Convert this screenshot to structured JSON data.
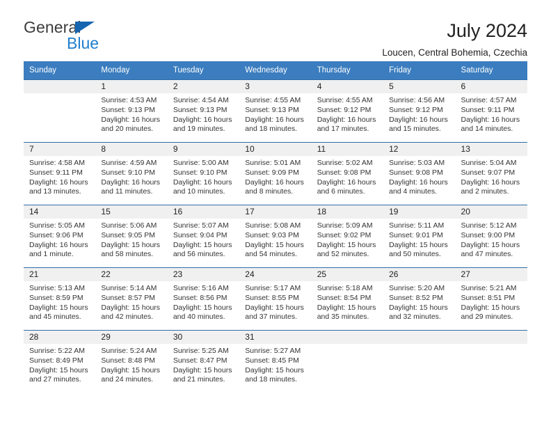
{
  "brand": {
    "name_top": "General",
    "name_bottom": "Blue",
    "accent_color": "#1f7fd0",
    "triangle_color": "#1565b0"
  },
  "header": {
    "title": "July 2024",
    "subtitle": "Loucen, Central Bohemia, Czechia"
  },
  "calendar": {
    "header_bg": "#3b7dbf",
    "row_divider": "#2f6ca8",
    "daynum_bg": "#f0f0f0",
    "weekdays": [
      "Sunday",
      "Monday",
      "Tuesday",
      "Wednesday",
      "Thursday",
      "Friday",
      "Saturday"
    ],
    "weeks": [
      [
        {
          "day": "",
          "info": ""
        },
        {
          "day": "1",
          "info": "Sunrise: 4:53 AM\nSunset: 9:13 PM\nDaylight: 16 hours\nand 20 minutes."
        },
        {
          "day": "2",
          "info": "Sunrise: 4:54 AM\nSunset: 9:13 PM\nDaylight: 16 hours\nand 19 minutes."
        },
        {
          "day": "3",
          "info": "Sunrise: 4:55 AM\nSunset: 9:13 PM\nDaylight: 16 hours\nand 18 minutes."
        },
        {
          "day": "4",
          "info": "Sunrise: 4:55 AM\nSunset: 9:12 PM\nDaylight: 16 hours\nand 17 minutes."
        },
        {
          "day": "5",
          "info": "Sunrise: 4:56 AM\nSunset: 9:12 PM\nDaylight: 16 hours\nand 15 minutes."
        },
        {
          "day": "6",
          "info": "Sunrise: 4:57 AM\nSunset: 9:11 PM\nDaylight: 16 hours\nand 14 minutes."
        }
      ],
      [
        {
          "day": "7",
          "info": "Sunrise: 4:58 AM\nSunset: 9:11 PM\nDaylight: 16 hours\nand 13 minutes."
        },
        {
          "day": "8",
          "info": "Sunrise: 4:59 AM\nSunset: 9:10 PM\nDaylight: 16 hours\nand 11 minutes."
        },
        {
          "day": "9",
          "info": "Sunrise: 5:00 AM\nSunset: 9:10 PM\nDaylight: 16 hours\nand 10 minutes."
        },
        {
          "day": "10",
          "info": "Sunrise: 5:01 AM\nSunset: 9:09 PM\nDaylight: 16 hours\nand 8 minutes."
        },
        {
          "day": "11",
          "info": "Sunrise: 5:02 AM\nSunset: 9:08 PM\nDaylight: 16 hours\nand 6 minutes."
        },
        {
          "day": "12",
          "info": "Sunrise: 5:03 AM\nSunset: 9:08 PM\nDaylight: 16 hours\nand 4 minutes."
        },
        {
          "day": "13",
          "info": "Sunrise: 5:04 AM\nSunset: 9:07 PM\nDaylight: 16 hours\nand 2 minutes."
        }
      ],
      [
        {
          "day": "14",
          "info": "Sunrise: 5:05 AM\nSunset: 9:06 PM\nDaylight: 16 hours\nand 1 minute."
        },
        {
          "day": "15",
          "info": "Sunrise: 5:06 AM\nSunset: 9:05 PM\nDaylight: 15 hours\nand 58 minutes."
        },
        {
          "day": "16",
          "info": "Sunrise: 5:07 AM\nSunset: 9:04 PM\nDaylight: 15 hours\nand 56 minutes."
        },
        {
          "day": "17",
          "info": "Sunrise: 5:08 AM\nSunset: 9:03 PM\nDaylight: 15 hours\nand 54 minutes."
        },
        {
          "day": "18",
          "info": "Sunrise: 5:09 AM\nSunset: 9:02 PM\nDaylight: 15 hours\nand 52 minutes."
        },
        {
          "day": "19",
          "info": "Sunrise: 5:11 AM\nSunset: 9:01 PM\nDaylight: 15 hours\nand 50 minutes."
        },
        {
          "day": "20",
          "info": "Sunrise: 5:12 AM\nSunset: 9:00 PM\nDaylight: 15 hours\nand 47 minutes."
        }
      ],
      [
        {
          "day": "21",
          "info": "Sunrise: 5:13 AM\nSunset: 8:59 PM\nDaylight: 15 hours\nand 45 minutes."
        },
        {
          "day": "22",
          "info": "Sunrise: 5:14 AM\nSunset: 8:57 PM\nDaylight: 15 hours\nand 42 minutes."
        },
        {
          "day": "23",
          "info": "Sunrise: 5:16 AM\nSunset: 8:56 PM\nDaylight: 15 hours\nand 40 minutes."
        },
        {
          "day": "24",
          "info": "Sunrise: 5:17 AM\nSunset: 8:55 PM\nDaylight: 15 hours\nand 37 minutes."
        },
        {
          "day": "25",
          "info": "Sunrise: 5:18 AM\nSunset: 8:54 PM\nDaylight: 15 hours\nand 35 minutes."
        },
        {
          "day": "26",
          "info": "Sunrise: 5:20 AM\nSunset: 8:52 PM\nDaylight: 15 hours\nand 32 minutes."
        },
        {
          "day": "27",
          "info": "Sunrise: 5:21 AM\nSunset: 8:51 PM\nDaylight: 15 hours\nand 29 minutes."
        }
      ],
      [
        {
          "day": "28",
          "info": "Sunrise: 5:22 AM\nSunset: 8:49 PM\nDaylight: 15 hours\nand 27 minutes."
        },
        {
          "day": "29",
          "info": "Sunrise: 5:24 AM\nSunset: 8:48 PM\nDaylight: 15 hours\nand 24 minutes."
        },
        {
          "day": "30",
          "info": "Sunrise: 5:25 AM\nSunset: 8:47 PM\nDaylight: 15 hours\nand 21 minutes."
        },
        {
          "day": "31",
          "info": "Sunrise: 5:27 AM\nSunset: 8:45 PM\nDaylight: 15 hours\nand 18 minutes."
        },
        {
          "day": "",
          "info": ""
        },
        {
          "day": "",
          "info": ""
        },
        {
          "day": "",
          "info": ""
        }
      ]
    ]
  }
}
